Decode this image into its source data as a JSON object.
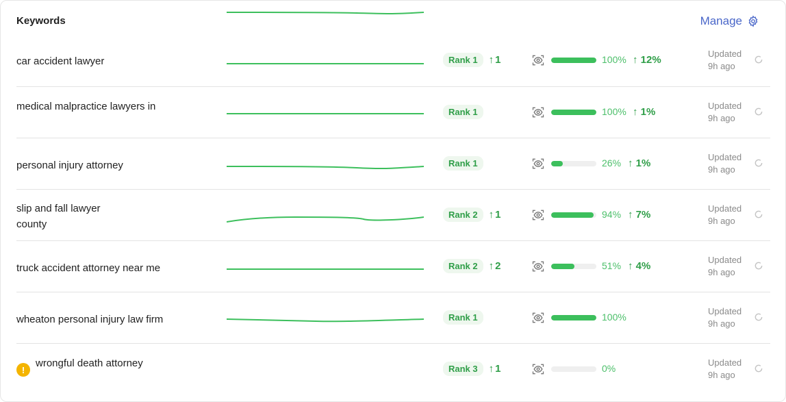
{
  "header": {
    "title": "Keywords",
    "manage_label": "Manage"
  },
  "colors": {
    "accent": "#4a67c9",
    "positive": "#2f9e48",
    "bar": "#3cbf5c",
    "warning": "#f4b400"
  },
  "rows": [
    {
      "keyword": "car accident lawyer",
      "keyword_line2": "",
      "rank": "Rank 1",
      "rank_delta": "1",
      "progress": 1.0,
      "percent": "100%",
      "percent_delta": "12%",
      "updated": "Updated",
      "updated_ago": "9h ago",
      "warning": false
    },
    {
      "keyword": "medical malpractice lawyers in",
      "keyword_line2": "",
      "rank": "Rank 1",
      "rank_delta": "",
      "progress": 1.0,
      "percent": "100%",
      "percent_delta": "1%",
      "updated": "Updated",
      "updated_ago": "9h ago",
      "warning": false
    },
    {
      "keyword": "personal injury attorney",
      "keyword_line2": "",
      "rank": "Rank 1",
      "rank_delta": "",
      "progress": 0.26,
      "percent": "26%",
      "percent_delta": "1%",
      "updated": "Updated",
      "updated_ago": "9h ago",
      "warning": false
    },
    {
      "keyword": "slip and fall lawyer",
      "keyword_line2": "county",
      "rank": "Rank 2",
      "rank_delta": "1",
      "progress": 0.94,
      "percent": "94%",
      "percent_delta": "7%",
      "updated": "Updated",
      "updated_ago": "9h ago",
      "warning": false
    },
    {
      "keyword": "truck accident attorney near me",
      "keyword_line2": "",
      "rank": "Rank 2",
      "rank_delta": "2",
      "progress": 0.51,
      "percent": "51%",
      "percent_delta": "4%",
      "updated": "Updated",
      "updated_ago": "9h ago",
      "warning": false
    },
    {
      "keyword": "wheaton personal injury law firm",
      "keyword_line2": "",
      "rank": "Rank 1",
      "rank_delta": "",
      "progress": 1.0,
      "percent": "100%",
      "percent_delta": "",
      "updated": "Updated",
      "updated_ago": "9h ago",
      "warning": false
    },
    {
      "keyword": "wrongful death attorney",
      "keyword_line2": "",
      "rank": "Rank 3",
      "rank_delta": "1",
      "progress": 0.0,
      "percent": "0%",
      "percent_delta": "",
      "updated": "Updated",
      "updated_ago": "9h ago",
      "warning": true
    }
  ]
}
